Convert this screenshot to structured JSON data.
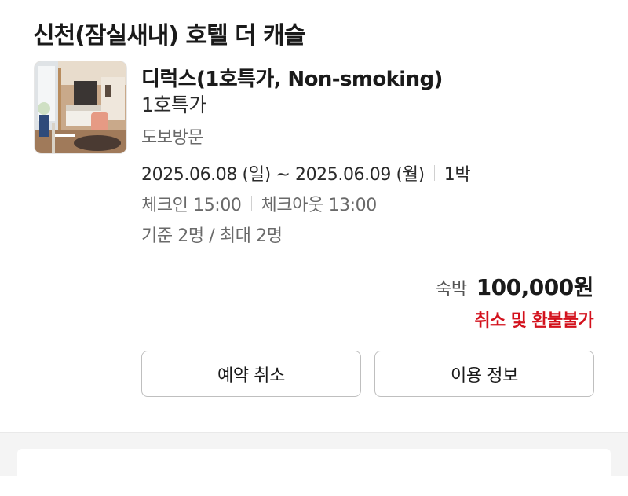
{
  "hotel": {
    "name": "신천(잠실새내) 호텔 더 캐슬"
  },
  "room": {
    "name": "디럭스(1호특가, Non-smoking)",
    "subtitle": "1호특가",
    "access": "도보방문",
    "thumbnail_icon": "hotel-room-photo"
  },
  "stay": {
    "dates": "2025.06.08 (일) ~ 2025.06.09 (월)",
    "nights": "1박",
    "check_in": "체크인 15:00",
    "check_out": "체크아웃 13:00",
    "occupancy": "기준 2명 / 최대 2명"
  },
  "price": {
    "label": "숙박",
    "value": "100,000원",
    "refund_policy": "취소 및 환불불가",
    "refund_color": "#d3111c"
  },
  "actions": {
    "cancel_label": "예약 취소",
    "info_label": "이용 정보"
  }
}
